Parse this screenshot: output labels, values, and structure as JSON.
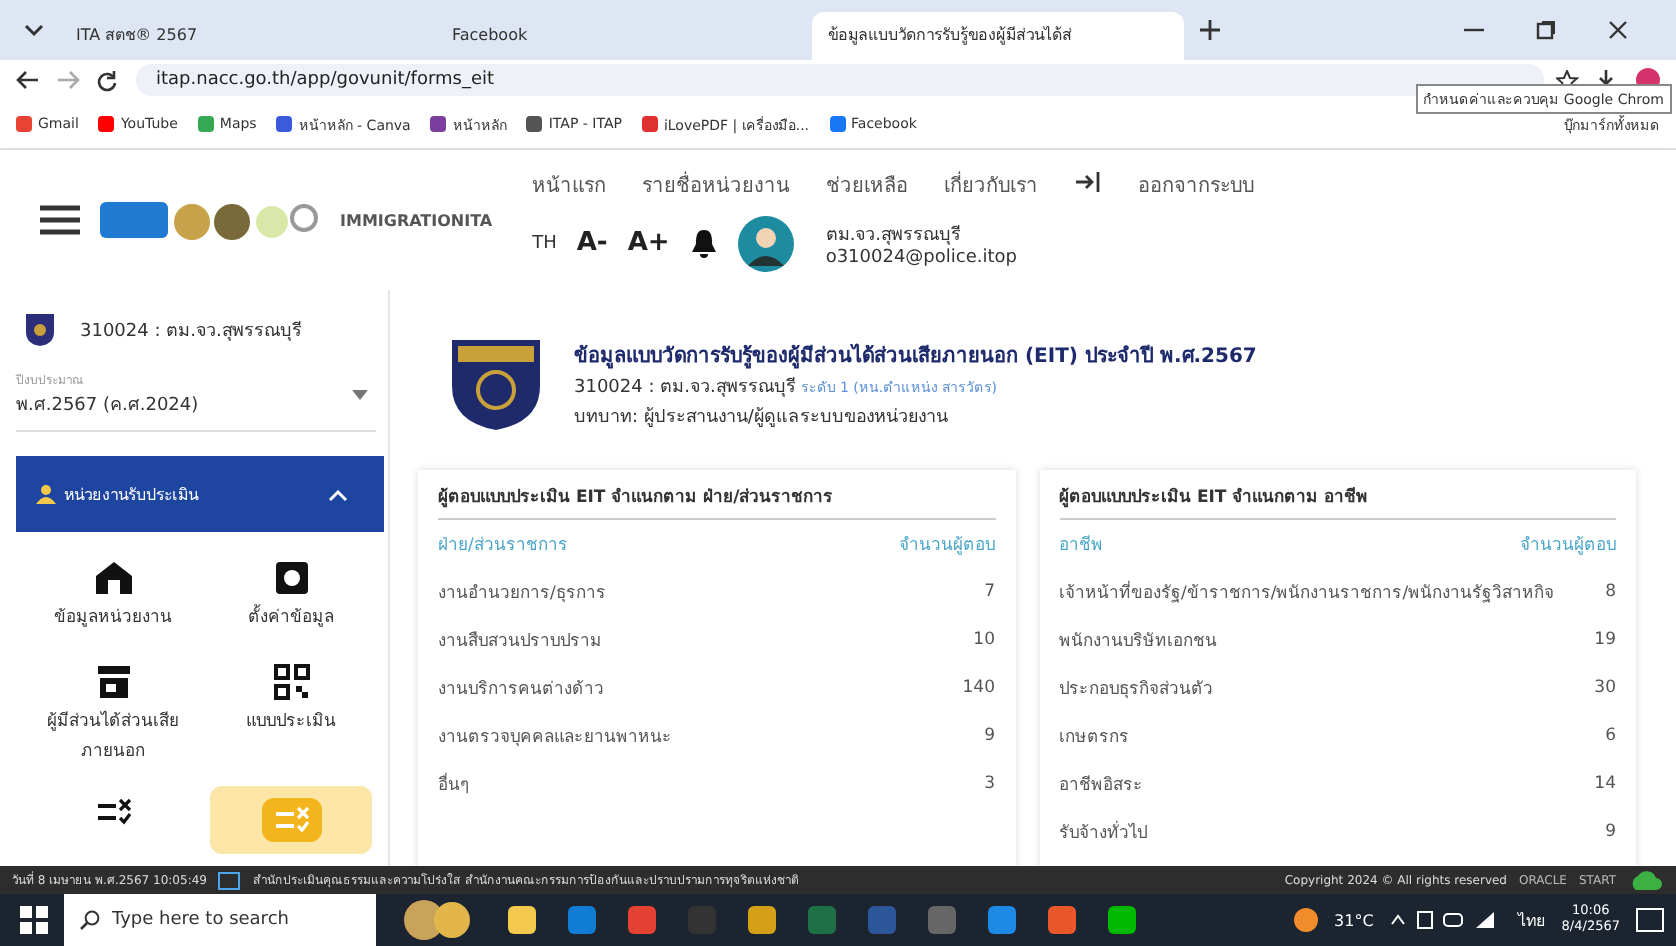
{
  "browser": {
    "tabs": [
      {
        "title": "ITA สตช® 2567",
        "selected": false
      },
      {
        "title": "Facebook",
        "selected": false
      },
      {
        "title": "ข้อมูลแบบวัดการรับรู้ของผู้มีส่วนได้ส่",
        "selected": true
      }
    ],
    "url": "itap.nacc.go.th/app/govunit/forms_eit",
    "bookmarks": [
      "Gmail",
      "YouTube",
      "Maps",
      "หน้าหลัก - Canva",
      "หน้าหลัก",
      "ITAP - ITAP",
      "iLovePDF | เครื่องมือ...",
      "Facebook"
    ],
    "tooltip": "กำหนดค่าและควบคุม Google Chrom",
    "all_bookmarks": "บุ๊กมาร์กทั้งหมด"
  },
  "header": {
    "brand": "IMMIGRATIONITA",
    "nav": [
      "หน้าแรก",
      "รายชื่อหน่วยงาน",
      "ช่วยเหลือ",
      "เกี่ยวกับเรา"
    ],
    "logout": "ออกจากระบบ",
    "lang": "TH",
    "font_buttons": [
      "A-",
      "A+"
    ],
    "user": {
      "name": "ตม.จว.สุพรรณบุรี",
      "email": "o310024@police.itop"
    }
  },
  "sidebar": {
    "unit": "310024 : ตม.จว.สุพรรณบุรี",
    "fiscal_label": "ปีงบประมาณ",
    "fiscal_value": "พ.ศ.2567 (ค.ศ.2024)",
    "menu_title": "หน่วยงานรับประเมิน",
    "expanded": true,
    "items": [
      {
        "kind": "home",
        "label": "ข้อมูลหน่วยงาน",
        "selected": false
      },
      {
        "kind": "settings",
        "label": "ตั้งค่าข้อมูล",
        "selected": false
      },
      {
        "kind": "store",
        "label": "ผู้มีส่วนได้ส่วนเสียภายนอก",
        "selected": false
      },
      {
        "kind": "qr",
        "label": "แบบประเมิน",
        "selected": false
      },
      {
        "kind": "checklist",
        "selected": false
      },
      {
        "kind": "checklist",
        "selected": true
      }
    ]
  },
  "main": {
    "title": "ข้อมูลแบบวัดการรับรู้ของผู้มีส่วนได้ส่วนเสียภายนอก (EIT) ประจำปี พ.ศ.2567",
    "unit": "310024 : ตม.จว.สุพรรณบุรี",
    "level": "ระดับ 1 (หน.ตำแหน่ง สารวัตร)",
    "role": "บทบาท: ผู้ประสานงาน/ผู้ดูแลระบบของหน่วยงาน",
    "tables": [
      {
        "title": "ผู้ตอบแบบประเมิน EIT จำแนกตาม ฝ่าย/ส่วนราชการ",
        "columns": [
          "ฝ่าย/ส่วนราชการ",
          "จำนวนผู้ตอบ"
        ],
        "rows": [
          [
            "งานอำนวยการ/ธุรการ",
            "7"
          ],
          [
            "งานสืบสวนปราบปราม",
            "10"
          ],
          [
            "งานบริการคนต่างด้าว",
            "140"
          ],
          [
            "งานตรวจบุคคลและยานพาหนะ",
            "9"
          ],
          [
            "อื่นๆ",
            "3"
          ]
        ]
      },
      {
        "title": "ผู้ตอบแบบประเมิน EIT จำแนกตาม อาชีพ",
        "columns": [
          "อาชีพ",
          "จำนวนผู้ตอบ"
        ],
        "rows": [
          [
            "เจ้าหน้าที่ของรัฐ/ข้าราชการ/พนักงานราชการ/พนักงานรัฐวิสาหกิจ",
            "8"
          ],
          [
            "พนักงานบริษัทเอกชน",
            "19"
          ],
          [
            "ประกอบธุรกิจส่วนตัว",
            "30"
          ],
          [
            "เกษตรกร",
            "6"
          ],
          [
            "อาชีพอิสระ",
            "14"
          ],
          [
            "รับจ้างทั่วไป",
            "9"
          ]
        ]
      }
    ]
  },
  "footer": {
    "date": "วันที่ 8 เมษายน พ.ศ.2567 10:05:49",
    "org": "สำนักประเมินคุณธรรมและความโปร่งใส สำนักงานคณะกรรมการป้องกันและปราบปรามการทุจริตแห่งชาติ",
    "copyright": "Copyright 2024 © All rights reserved",
    "links": [
      "ORACLE",
      "START"
    ]
  },
  "taskbar": {
    "search": "Type here to search",
    "weather": "31°C",
    "lang": "ไทย",
    "time": "10:06",
    "date": "8/4/2567"
  }
}
